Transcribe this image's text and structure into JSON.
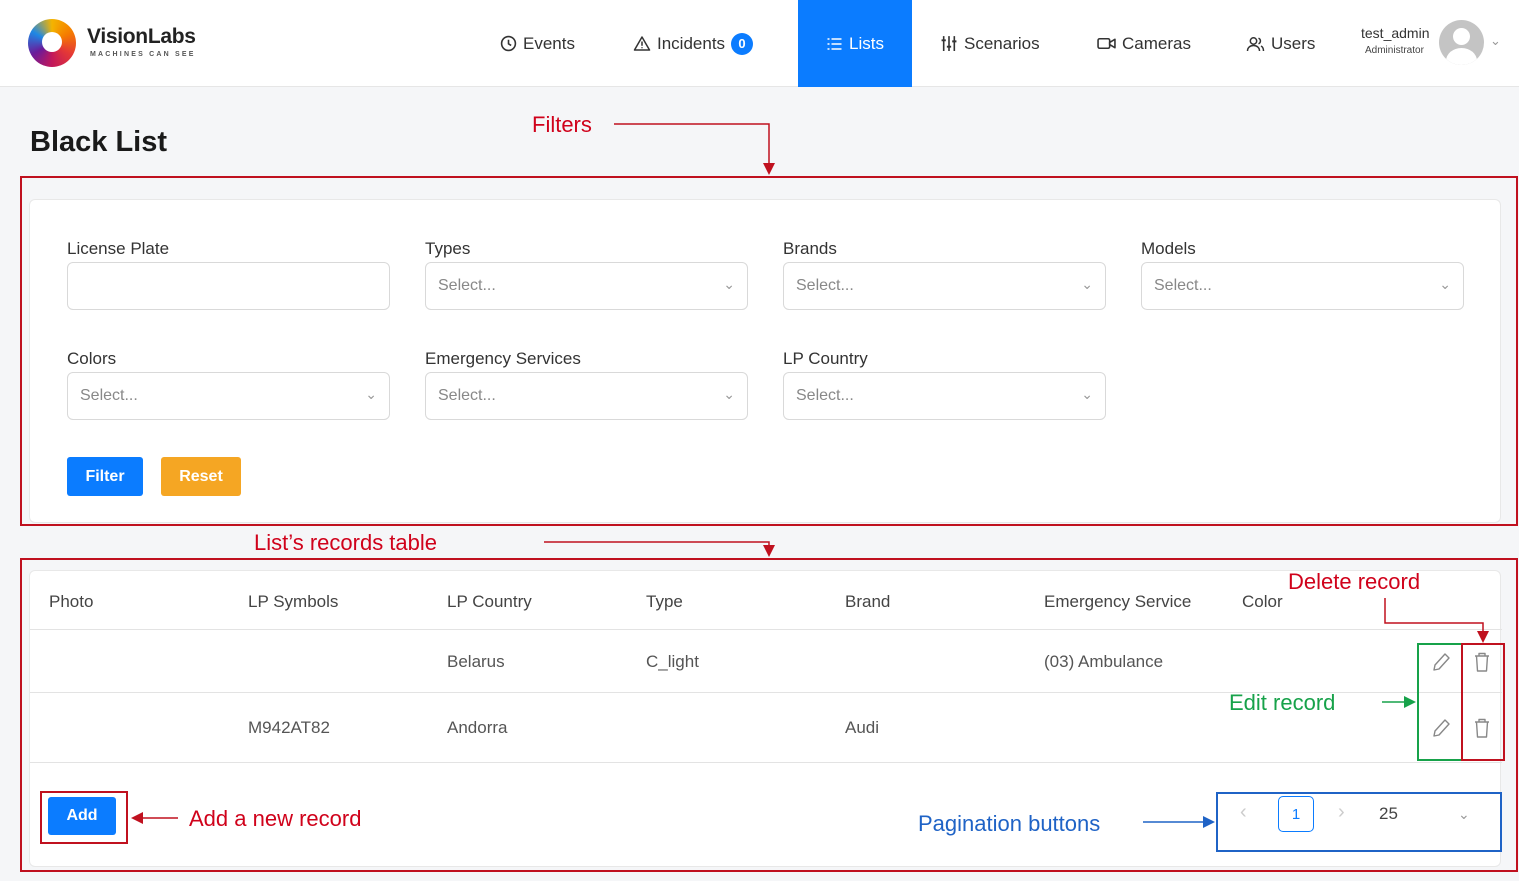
{
  "brand": {
    "name": "VisionLabs",
    "tagline": "MACHINES CAN SEE"
  },
  "nav": {
    "events": {
      "label": "Events",
      "icon": "clock-icon"
    },
    "incidents": {
      "label": "Incidents",
      "icon": "warning-icon",
      "badge": "0"
    },
    "lists": {
      "label": "Lists",
      "icon": "list-icon",
      "active": true
    },
    "scenarios": {
      "label": "Scenarios",
      "icon": "sliders-icon"
    },
    "cameras": {
      "label": "Cameras",
      "icon": "camera-icon"
    },
    "users": {
      "label": "Users",
      "icon": "users-icon"
    }
  },
  "user": {
    "name": "test_admin",
    "role": "Administrator"
  },
  "page": {
    "title": "Black List"
  },
  "filters": {
    "license_plate": {
      "label": "License Plate",
      "value": ""
    },
    "types": {
      "label": "Types",
      "placeholder": "Select..."
    },
    "brands": {
      "label": "Brands",
      "placeholder": "Select..."
    },
    "models": {
      "label": "Models",
      "placeholder": "Select..."
    },
    "colors": {
      "label": "Colors",
      "placeholder": "Select..."
    },
    "emergency": {
      "label": "Emergency Services",
      "placeholder": "Select..."
    },
    "lp_country": {
      "label": "LP Country",
      "placeholder": "Select..."
    },
    "filter_button": "Filter",
    "reset_button": "Reset"
  },
  "table": {
    "headers": [
      "Photo",
      "LP Symbols",
      "LP Country",
      "Type",
      "Brand",
      "Emergency Service",
      "Color"
    ],
    "rows": [
      {
        "photo": "",
        "lp_symbols": "",
        "lp_country": "Belarus",
        "type": "C_light",
        "brand": "",
        "emergency_service": "(03) Ambulance",
        "color": ""
      },
      {
        "photo": "",
        "lp_symbols": "M942AT82",
        "lp_country": "Andorra",
        "type": "",
        "brand": "Audi",
        "emergency_service": "",
        "color": ""
      }
    ],
    "add_button": "Add"
  },
  "pagination": {
    "current_page": "1",
    "page_size": "25"
  },
  "annotations": {
    "filters": "Filters",
    "records_table": "List’s records table",
    "delete_record": "Delete record",
    "edit_record": "Edit record",
    "add_record": "Add a new record",
    "pagination": "Pagination buttons"
  },
  "colors": {
    "accent": "#0b7cff",
    "reset": "#f5a623",
    "annotation_red": "#d0021b",
    "annotation_green": "#17a24a",
    "annotation_blue": "#1f63c6"
  }
}
